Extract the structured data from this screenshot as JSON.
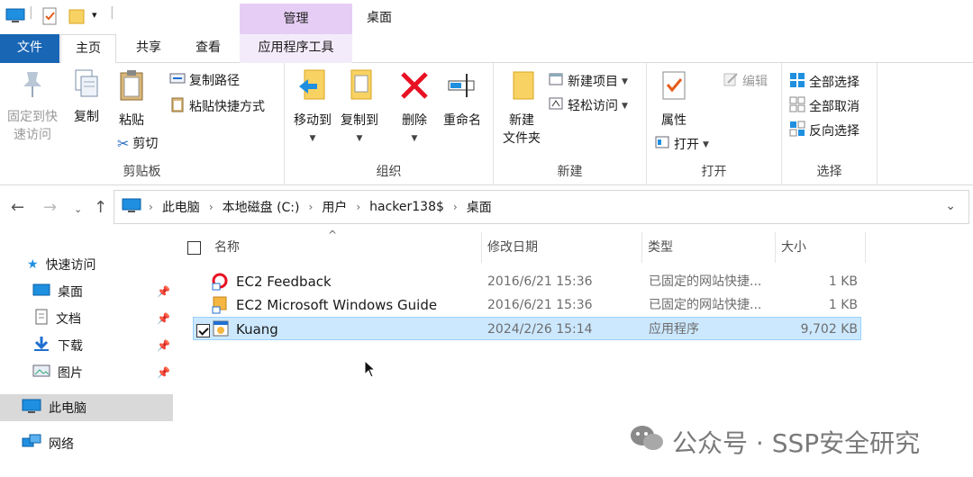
{
  "title_bar": {
    "context_group": "管理",
    "window_title": "桌面"
  },
  "tabs": {
    "file": "文件",
    "home": "主页",
    "share": "共享",
    "view": "查看",
    "app_tools": "应用程序工具"
  },
  "ribbon": {
    "clipboard": {
      "label": "剪贴板",
      "pin_quick_access_line1": "固定到快",
      "pin_quick_access_line2": "速访问",
      "copy": "复制",
      "paste": "粘贴",
      "copy_path": "复制路径",
      "paste_shortcut": "粘贴快捷方式",
      "cut": "剪切"
    },
    "organize": {
      "label": "组织",
      "move_to": "移动到",
      "copy_to": "复制到",
      "delete": "删除",
      "rename": "重命名"
    },
    "new": {
      "label": "新建",
      "new_folder_line1": "新建",
      "new_folder_line2": "文件夹",
      "new_item": "新建项目",
      "easy_access": "轻松访问"
    },
    "open": {
      "label": "打开",
      "properties": "属性",
      "open": "打开",
      "edit": "编辑"
    },
    "select": {
      "label": "选择",
      "select_all": "全部选择",
      "select_none": "全部取消",
      "invert": "反向选择"
    }
  },
  "address": {
    "crumbs": [
      "此电脑",
      "本地磁盘 (C:)",
      "用户",
      "hacker138$",
      "桌面"
    ]
  },
  "nav_pane": {
    "quick_access": "快速访问",
    "desktop": "桌面",
    "documents": "文档",
    "downloads": "下载",
    "pictures": "图片",
    "this_pc": "此电脑",
    "network": "网络"
  },
  "columns": {
    "name": "名称",
    "modified": "修改日期",
    "type": "类型",
    "size": "大小"
  },
  "files": [
    {
      "name": "EC2 Feedback",
      "modified": "2016/6/21 15:36",
      "type": "已固定的网站快捷...",
      "size": "1 KB",
      "selected": false
    },
    {
      "name": "EC2 Microsoft Windows Guide",
      "modified": "2016/6/21 15:36",
      "type": "已固定的网站快捷...",
      "size": "1 KB",
      "selected": false
    },
    {
      "name": "Kuang",
      "modified": "2024/2/26 15:14",
      "type": "应用程序",
      "size": "9,702 KB",
      "selected": true
    }
  ],
  "watermark": "公众号 · SSP安全研究",
  "colors": {
    "file_tab": "#1966b5",
    "context_tab": "#e6cdf5",
    "selection": "#cce8ff",
    "delete_red": "#e81123"
  }
}
